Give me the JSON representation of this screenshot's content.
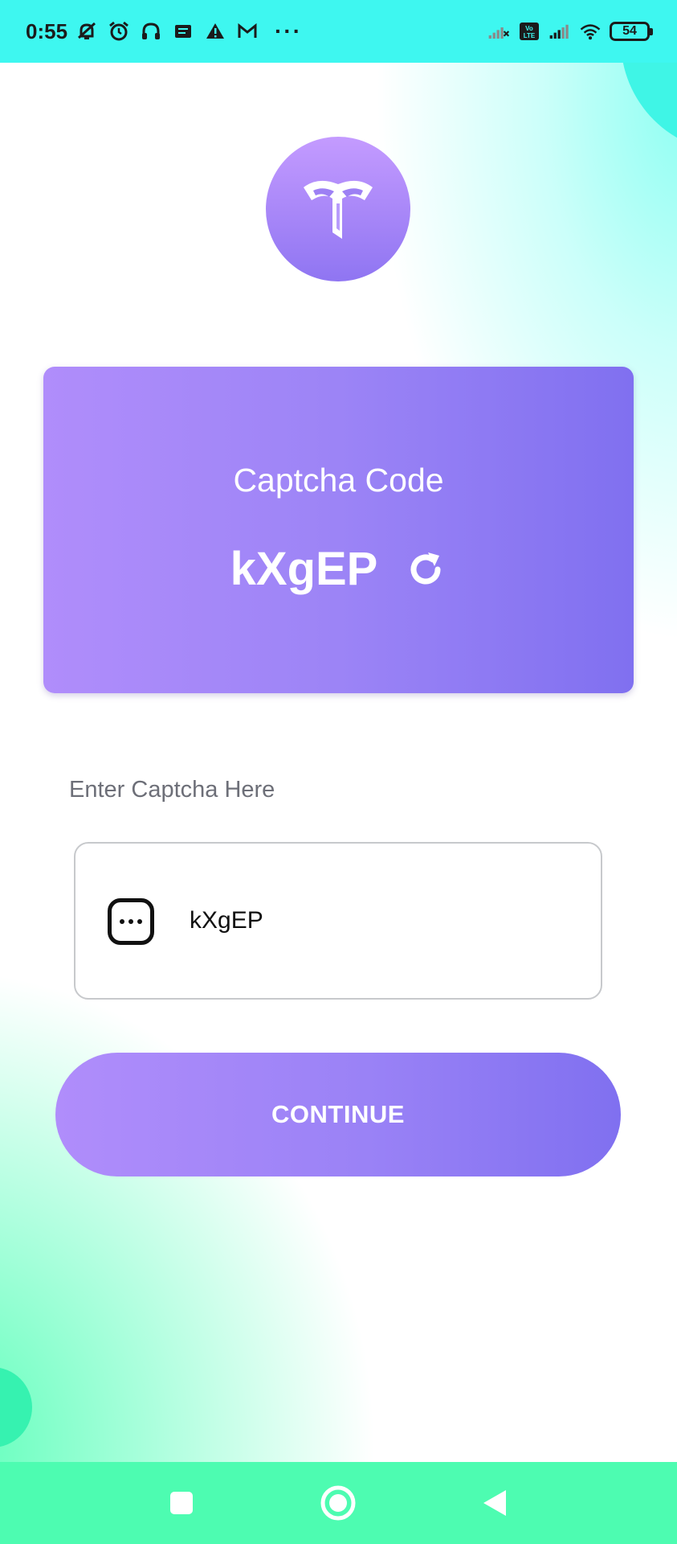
{
  "status_bar": {
    "time": "0:55",
    "more": "···",
    "battery": "54",
    "volte": "Vo LTE",
    "icons": [
      "notifications-off-icon",
      "alarm-icon",
      "headphones-icon",
      "message-icon",
      "warning-icon",
      "gmail-icon",
      "signal-off-icon",
      "volte-icon",
      "signal-icon",
      "wifi-icon",
      "battery-icon"
    ]
  },
  "logo": {
    "icon": "app-logo-icon"
  },
  "captcha_card": {
    "title": "Captcha Code",
    "code": "kXgEP",
    "refresh_icon": "refresh-icon"
  },
  "input": {
    "label": "Enter Captcha Here",
    "value": "kXgEP",
    "icon": "dots-box-icon"
  },
  "continue_button": {
    "label": "CONTINUE"
  },
  "nav_bar": {
    "items": [
      "recents-button",
      "home-button",
      "back-button"
    ]
  },
  "colors": {
    "status_bar": "#3ef7f0",
    "card_gradient_start": "#b08dfb",
    "card_gradient_end": "#8070f0",
    "nav_bar": "#4dfcb1",
    "label_text": "#6d6f78"
  }
}
